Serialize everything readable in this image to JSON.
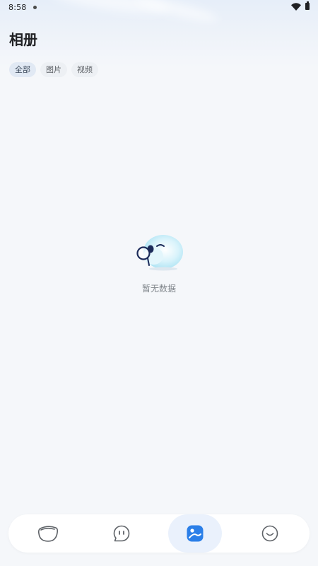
{
  "status_bar": {
    "time": "8:58",
    "icons": [
      "notification-dot-icon",
      "wifi-icon",
      "battery-icon"
    ]
  },
  "header": {
    "title": "相册"
  },
  "filter_tabs": [
    {
      "label": "全部",
      "active": true
    },
    {
      "label": "图片",
      "active": false
    },
    {
      "label": "视频",
      "active": false
    }
  ],
  "empty_state": {
    "illustration": "cloud-magnifier-icon",
    "message": "暂无数据"
  },
  "bottom_nav": {
    "items": [
      {
        "icon": "bubble-icon",
        "active": false
      },
      {
        "icon": "chat-face-icon",
        "active": false
      },
      {
        "icon": "album-icon",
        "active": true
      },
      {
        "icon": "smile-icon",
        "active": false
      }
    ],
    "active_color": "#2b7fe8"
  },
  "colors": {
    "background": "#f5f7fa",
    "accent": "#2b7fe8",
    "title_text": "#202124",
    "muted_text": "#80868b"
  }
}
